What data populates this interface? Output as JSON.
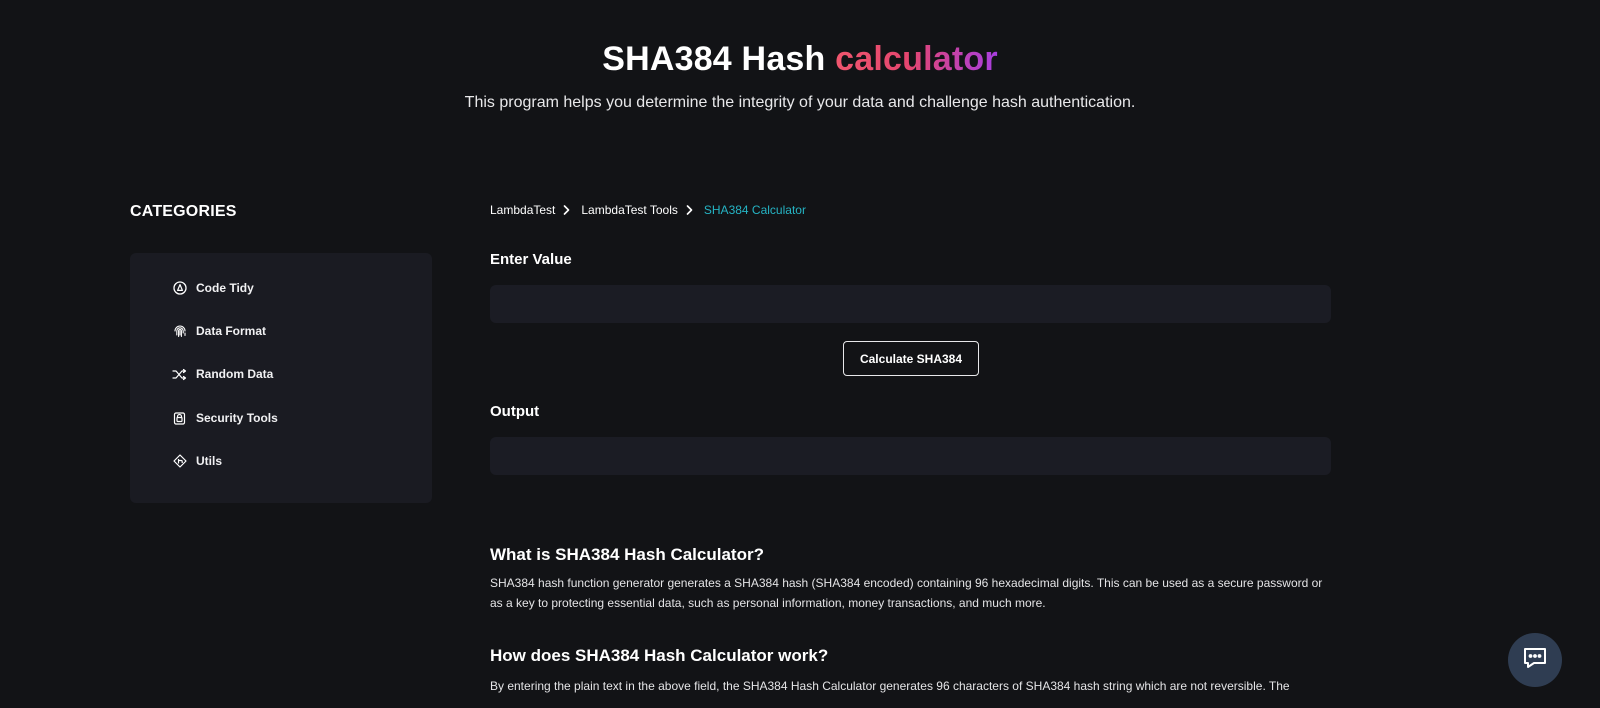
{
  "hero": {
    "title_main": "SHA384 Hash ",
    "title_accent": "calculator",
    "subtitle": "This program helps you determine the integrity of your data and challenge hash authentication."
  },
  "sidebar": {
    "heading": "CATEGORIES",
    "items": [
      {
        "label": "Code Tidy",
        "icon": "code-tidy-icon"
      },
      {
        "label": "Data Format",
        "icon": "fingerprint-icon"
      },
      {
        "label": "Random Data",
        "icon": "shuffle-icon"
      },
      {
        "label": "Security Tools",
        "icon": "lock-icon"
      },
      {
        "label": "Utils",
        "icon": "utils-icon"
      }
    ]
  },
  "breadcrumb": {
    "items": [
      "LambdaTest",
      "LambdaTest Tools"
    ],
    "current": "SHA384 Calculator"
  },
  "form": {
    "input_label": "Enter Value",
    "input_value": "",
    "button_label": "Calculate SHA384",
    "output_label": "Output",
    "output_value": ""
  },
  "content": {
    "sections": [
      {
        "heading": "What is SHA384 Hash Calculator?",
        "body": "SHA384 hash function generator generates a SHA384 hash (SHA384 encoded) containing 96 hexadecimal digits. This can be used as a secure password or as a key to protecting essential data, such as personal information, money transactions, and much more."
      },
      {
        "heading": "How does SHA384 Hash Calculator work?",
        "body": "By entering the plain text in the above field, the SHA384 Hash Calculator generates 96 characters of SHA384 hash string which are not reversible. The"
      }
    ]
  },
  "colors": {
    "background": "#121316",
    "panel": "#1a1b22",
    "accent_start": "#f0566e",
    "accent_end": "#a73ee0",
    "breadcrumb_current": "#25b4c4",
    "chat_button": "#2f3d52"
  },
  "chat": {
    "icon": "chat-icon"
  }
}
